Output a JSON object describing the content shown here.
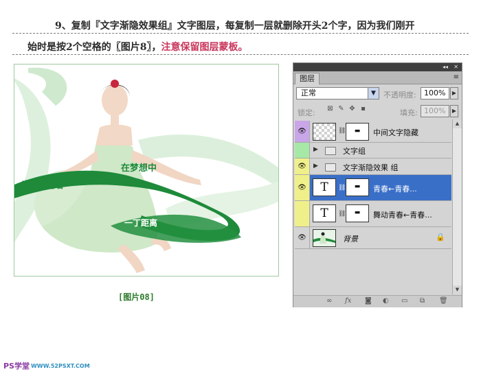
{
  "instructions": {
    "line1": "9、复制『文字渐隐效果组』文字图层，每复制一层就删除开头2个字，因为我们刚开",
    "line2_plain": "始时是按2个空格的〖图片8〗，",
    "line2_accent": "注意保留图层蒙板。"
  },
  "photo": {
    "caption": "[图片08]",
    "ribbon_text_1": "青春←青春",
    "ribbon_text_2": "在梦想中",
    "ribbon_text_3": "一丁距离"
  },
  "panel": {
    "tab": "图层",
    "menu_icon": "≡",
    "collapse_icon": "◂◂",
    "close_icon": "✕",
    "blend_mode": "正常",
    "opacity_label": "不透明度:",
    "opacity_value": "100%",
    "lock_label": "锁定:",
    "fill_label": "填充:",
    "fill_value": "100%",
    "layers": [
      {
        "name": "中间文字隐藏",
        "type": "pixel",
        "visible": true,
        "color": "#c9a6e8",
        "selected": false
      },
      {
        "name": "文字组",
        "type": "group",
        "visible": false,
        "color": "#a6e8a6",
        "selected": false
      },
      {
        "name": "文字渐隐效果 组",
        "type": "group",
        "visible": true,
        "color": "#f0f08a",
        "selected": false
      },
      {
        "name": "青春←青春...",
        "type": "text",
        "visible": true,
        "color": "#f0f08a",
        "selected": true
      },
      {
        "name": "舞动青春←青春...",
        "type": "text",
        "visible": false,
        "color": "#f0f08a",
        "selected": false
      },
      {
        "name": "背景",
        "type": "background",
        "visible": true,
        "color": "#d4d4d4",
        "selected": false
      }
    ],
    "footer_icons": [
      "link-icon",
      "fx-icon",
      "mask-icon",
      "adjustment-icon",
      "folder-icon",
      "new-layer-icon",
      "trash-icon"
    ]
  },
  "logo": {
    "text1": "PS学堂",
    "text2": "WWW.52PSXT.COM"
  },
  "colors": {
    "selected": "#3a6fc8",
    "accent": "#c8355a",
    "ribbon": "#1e8a3a"
  }
}
